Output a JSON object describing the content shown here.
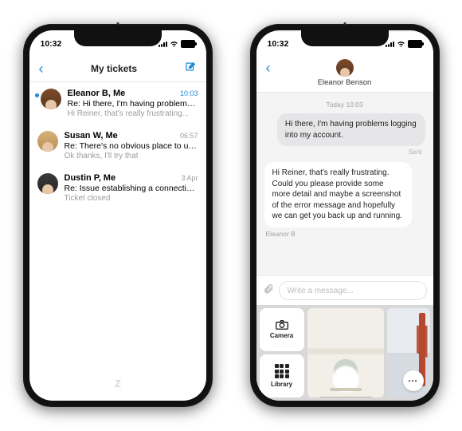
{
  "status": {
    "time": "10:32"
  },
  "left": {
    "title": "My tickets",
    "tickets": [
      {
        "sender": "Eleanor B, Me",
        "time": "10:03",
        "subject": "Re: Hi there, I'm having problems l...",
        "preview": "Hi Reiner, that's really frustrating...",
        "unread": true
      },
      {
        "sender": "Susan W, Me",
        "time": "06:57",
        "subject": "Re: There's no obvious place to up...",
        "preview": "Ok thanks, I'll try that"
      },
      {
        "sender": "Dustin P, Me",
        "time": "3 Apr",
        "subject": "Re: Issue establishing a connection...",
        "preview": "Ticket closed"
      }
    ]
  },
  "right": {
    "contact": "Eleanor Benson",
    "date": "Today 10:03",
    "user_msg": "Hi there, I'm having problems logging into my account.",
    "sent_label": "Sent",
    "agent_msg": "Hi Reiner, that's really frustrating. Could you please provide some more detail and maybe a screenshot of the error message and hopefully we can get you back up and running.",
    "agent_name": "Eleanor B",
    "placeholder": "Write a message...",
    "tray": {
      "camera": "Camera",
      "library": "Library"
    }
  }
}
